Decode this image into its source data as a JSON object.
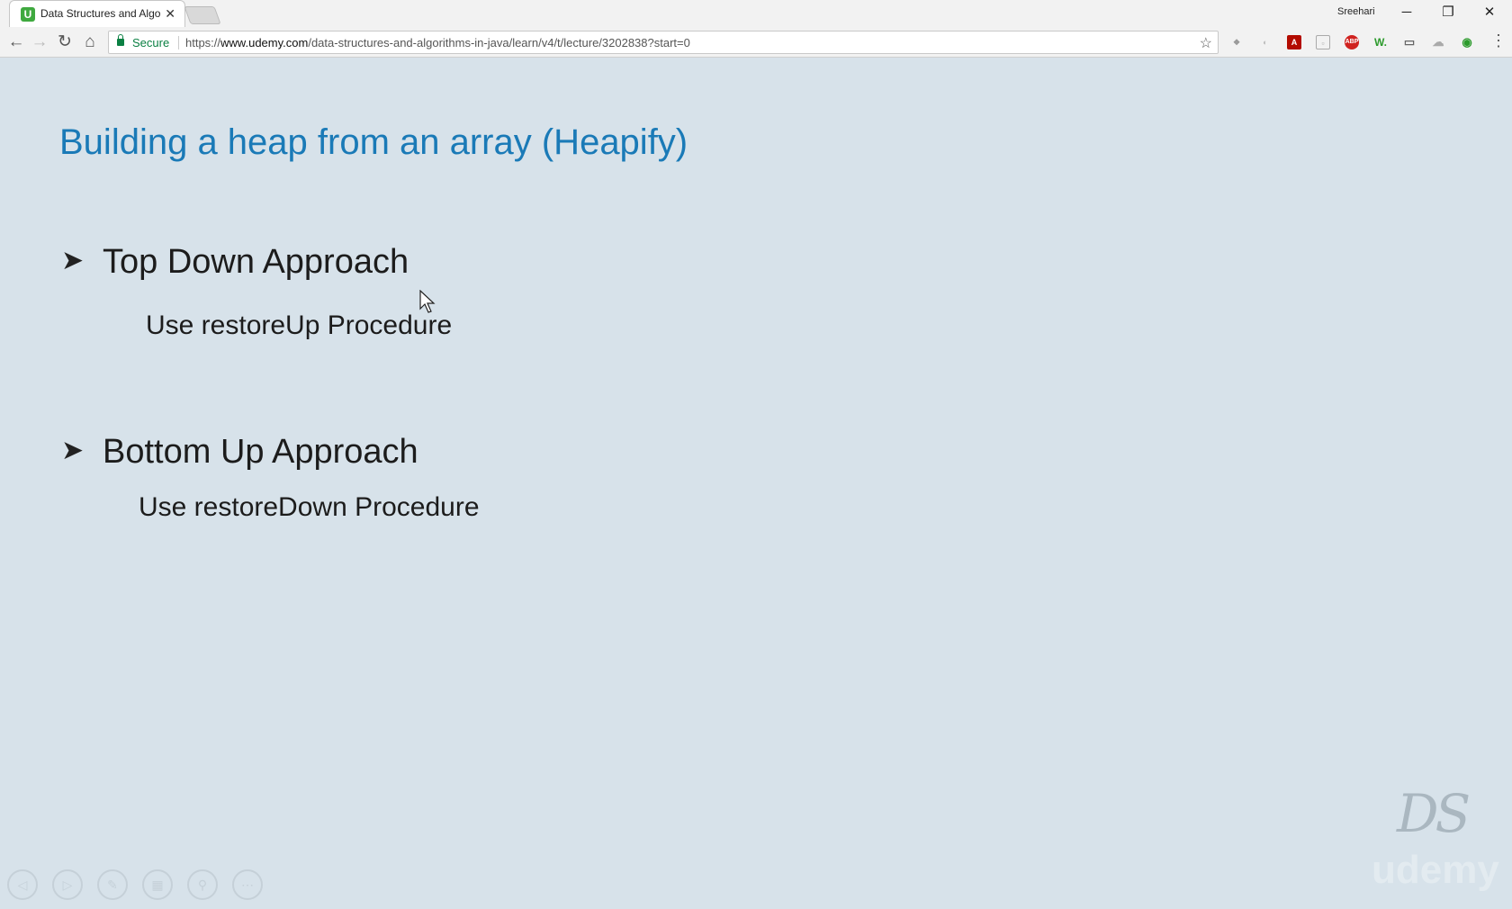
{
  "browser": {
    "tab_title": "Data Structures and Algo",
    "tab_favicon": "U",
    "profile_name": "Sreehari",
    "secure_label": "Secure",
    "url_scheme": "https://",
    "url_host": "www.udemy.com",
    "url_path": "/data-structures-and-algorithms-in-java/learn/v4/t/lecture/3202838?start=0",
    "extensions": [
      "ext-icon",
      "ext-icon",
      "acrobat-icon",
      "ext-icon",
      "adblock-icon",
      "word-icon",
      "cast-icon",
      "cloud-icon",
      "sound-icon"
    ]
  },
  "slide": {
    "title": "Building a heap from an array (Heapify)",
    "items": [
      {
        "heading": "Top Down Approach",
        "detail": "Use restoreUp Procedure"
      },
      {
        "heading": "Bottom Up Approach",
        "detail": "Use restoreDown Procedure"
      }
    ],
    "logo_text": "DS",
    "watermark": "udemy"
  },
  "colors": {
    "title": "#1a7ab7",
    "slide_bg": "#d7e2ea",
    "secure": "#0b8043"
  }
}
